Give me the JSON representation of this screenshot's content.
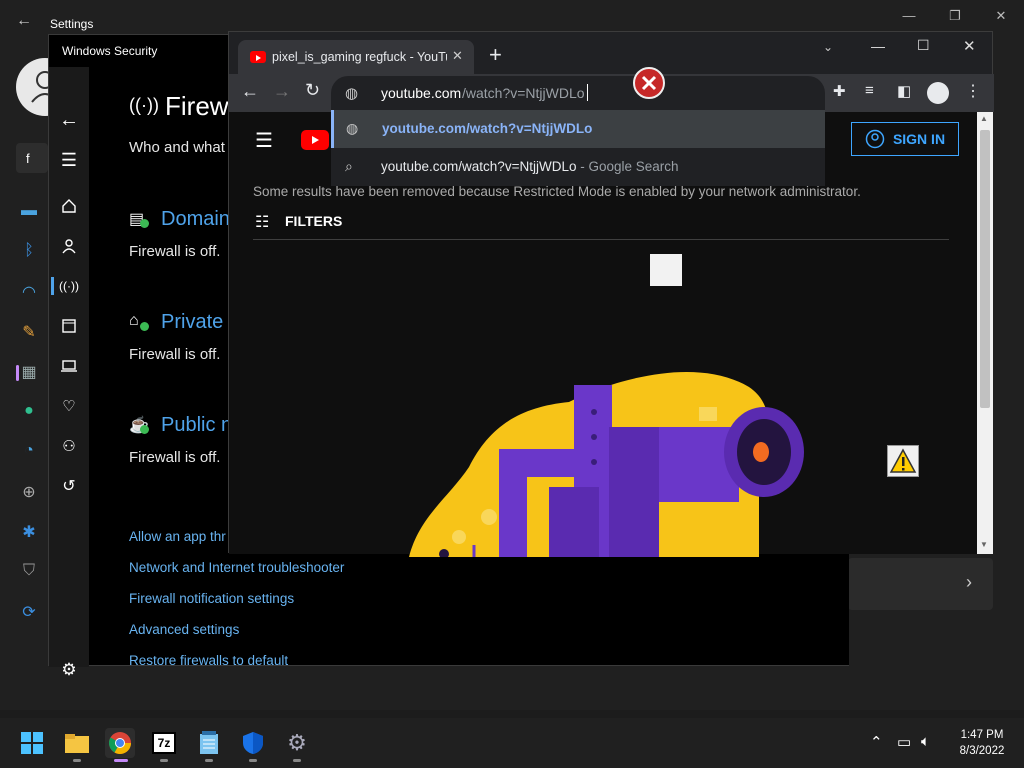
{
  "settings": {
    "title": "Settings",
    "search_value": "f"
  },
  "windows_security": {
    "title": "Windows Security",
    "page_title": "Firewa",
    "page_subtitle": "Who and what",
    "sections": [
      {
        "title": "Domain",
        "status": "Firewall is off."
      },
      {
        "title": "Private n",
        "status": "Firewall is off."
      },
      {
        "title": "Public n",
        "status": "Firewall is off."
      }
    ],
    "links": [
      "Allow an app thr",
      "Network and Internet troubleshooter",
      "Firewall notification settings",
      "Advanced settings",
      "Restore firewalls to default"
    ]
  },
  "chrome": {
    "tab_title": "pixel_is_gaming regfuck - YouTube",
    "omnibox": {
      "host": "youtube.com",
      "path": "/watch?v=NtjjWDLo"
    },
    "suggestions": [
      {
        "text": "youtube.com/watch?v=NtjjWDLo",
        "suffix": ""
      },
      {
        "text": "youtube.com/watch?v=NtjjWDLo",
        "suffix": " - Google Search"
      }
    ],
    "youtube": {
      "sign_in": "SIGN IN",
      "notice": "Some results have been removed because Restricted Mode is enabled by your network administrator.",
      "filters": "FILTERS"
    }
  },
  "taskbar": {
    "clock_time": "1:47 PM",
    "clock_date": "8/3/2022",
    "app_7z": "7z"
  },
  "colors": {
    "accent_blue": "#4fa3ea",
    "link_blue": "#68b3f0",
    "yt_red": "#ff0000",
    "illustration_yellow": "#f7c418",
    "illustration_purple": "#6a37c9"
  }
}
